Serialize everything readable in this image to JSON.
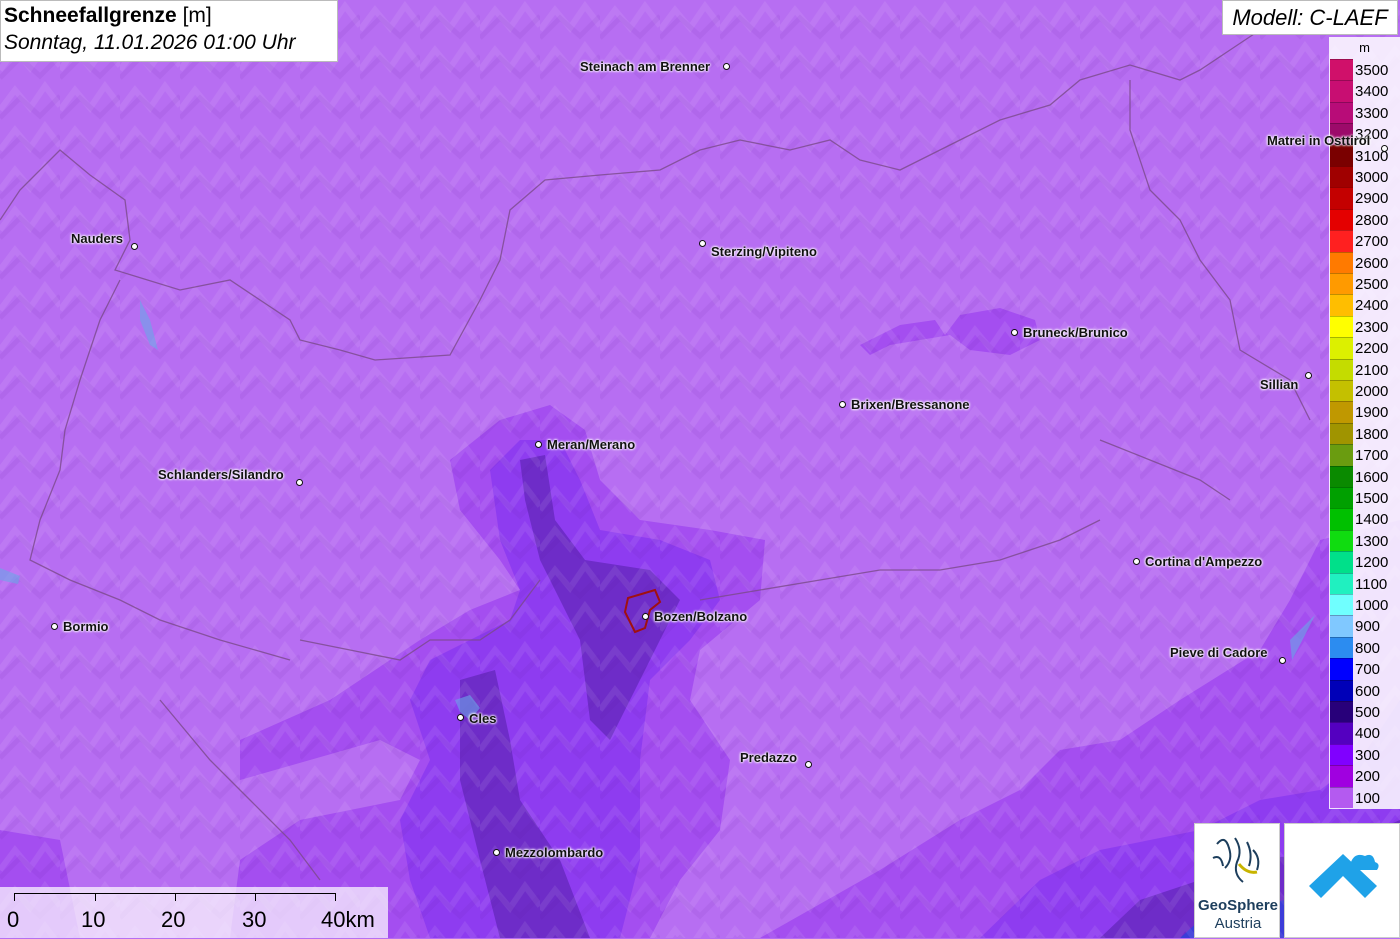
{
  "title": {
    "name": "Schneefallgrenze",
    "unit": "[m]",
    "datetime": "Sonntag, 11.01.2026 01:00 Uhr"
  },
  "model": "Modell: C-LAEF",
  "legend": {
    "unit": "m",
    "entries": [
      {
        "label": "3500",
        "color": "#d0106a"
      },
      {
        "label": "3400",
        "color": "#c80e72"
      },
      {
        "label": "3300",
        "color": "#b80c78"
      },
      {
        "label": "3200",
        "color": "#9c0a6a"
      },
      {
        "label": "3100",
        "color": "#7a0000"
      },
      {
        "label": "3000",
        "color": "#a00000"
      },
      {
        "label": "2900",
        "color": "#c40000"
      },
      {
        "label": "2800",
        "color": "#e40000"
      },
      {
        "label": "2700",
        "color": "#ff2020"
      },
      {
        "label": "2600",
        "color": "#ff7a00"
      },
      {
        "label": "2500",
        "color": "#ff9a00"
      },
      {
        "label": "2400",
        "color": "#ffbe00"
      },
      {
        "label": "2300",
        "color": "#ffff00"
      },
      {
        "label": "2200",
        "color": "#dcf000"
      },
      {
        "label": "2100",
        "color": "#c4dc00"
      },
      {
        "label": "2000",
        "color": "#c4c000"
      },
      {
        "label": "1900",
        "color": "#c09800"
      },
      {
        "label": "1800",
        "color": "#a09400"
      },
      {
        "label": "1700",
        "color": "#6a9c10"
      },
      {
        "label": "1600",
        "color": "#0a8a00"
      },
      {
        "label": "1500",
        "color": "#00a000"
      },
      {
        "label": "1400",
        "color": "#00c000"
      },
      {
        "label": "1300",
        "color": "#10dc10"
      },
      {
        "label": "1200",
        "color": "#00e08a"
      },
      {
        "label": "1100",
        "color": "#20f0c0"
      },
      {
        "label": "1000",
        "color": "#70ffff"
      },
      {
        "label": "900",
        "color": "#80c8ff"
      },
      {
        "label": "800",
        "color": "#2c8cf0"
      },
      {
        "label": "700",
        "color": "#0000ff"
      },
      {
        "label": "600",
        "color": "#0000b8"
      },
      {
        "label": "500",
        "color": "#28007a"
      },
      {
        "label": "400",
        "color": "#5400c0"
      },
      {
        "label": "300",
        "color": "#8000ff"
      },
      {
        "label": "200",
        "color": "#a000e0"
      },
      {
        "label": "100",
        "color": "#b45af0"
      }
    ]
  },
  "places": [
    {
      "name": "Steinach am Brenner"
    },
    {
      "name": "Matrei in Osttirol"
    },
    {
      "name": "Nauders"
    },
    {
      "name": "Sterzing/Vipiteno"
    },
    {
      "name": "Bruneck/Brunico"
    },
    {
      "name": "Sillian"
    },
    {
      "name": "Brixen/Bressanone"
    },
    {
      "name": "Meran/Merano"
    },
    {
      "name": "Schlanders/Silandro"
    },
    {
      "name": "Cortina d'Ampezzo"
    },
    {
      "name": "Bormio"
    },
    {
      "name": "Bozen/Bolzano"
    },
    {
      "name": "Pieve di Cadore"
    },
    {
      "name": "Cles"
    },
    {
      "name": "Predazzo"
    },
    {
      "name": "Mezzolombardo"
    }
  ],
  "scale": {
    "labels": [
      "0",
      "10",
      "20",
      "30",
      "40km"
    ]
  },
  "logo": {
    "name": "GeoSphere",
    "sub": "Austria"
  }
}
